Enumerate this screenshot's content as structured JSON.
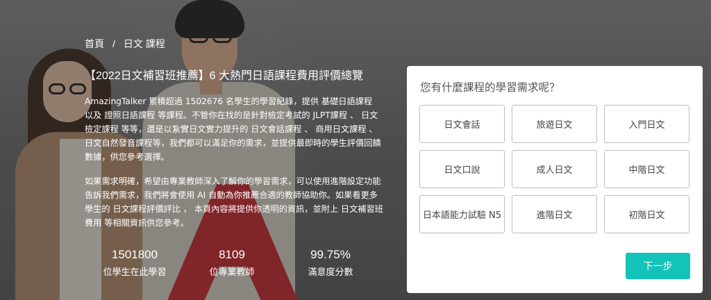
{
  "breadcrumb": {
    "home": "首頁",
    "separator": "/",
    "current": "日文 課程"
  },
  "headline": "【2022日文補習班推薦】6 大熱門日語課程費用評價總覽",
  "intro": {
    "p1": "AmazingTalker 累積超過 1502676 名學生的學習紀錄，提供 基礎日語課程 以及 證照日語課程 等課程。不管你在找的是針對檢定考試的 JLPT課程 、 日文檢定課程 等等，還是以紮實日文實力提升的 日文會話課程 、 商用日文課程 、 日文自然發音課程等，我們都可以滿足你的需求，並提供最即時的學生評價回饋數據，供您參考選擇。",
    "p2": "如果需求明確，希望由專業教師深入了解你的學習需求，可以使用進階設定功能告訴我們需求，我們將會使用 AI 自動為你推薦合適的教師協助你。如果看更多學生的 日文課程評價評比 ， 本頁內容將提供你透明的資訊，並附上 日文補習班費用 等相關資訊供您參考。"
  },
  "stats": [
    {
      "value": "1501800",
      "label": "位學生在此學習"
    },
    {
      "value": "8109",
      "label": "位專業教師"
    },
    {
      "value": "99.75%",
      "label": "滿意度分數"
    }
  ],
  "card": {
    "title": "您有什麼課程的學習需求呢？",
    "options": [
      "日文會話",
      "旅遊日文",
      "入門日文",
      "日文口說",
      "成人日文",
      "中階日文",
      "日本語能力試驗 N5",
      "進階日文",
      "初階日文"
    ],
    "next_label": "下一步"
  },
  "colors": {
    "accent": "#13c3b7",
    "hero_overlay": "#5a5a5a",
    "brand_red": "#c8141b"
  }
}
